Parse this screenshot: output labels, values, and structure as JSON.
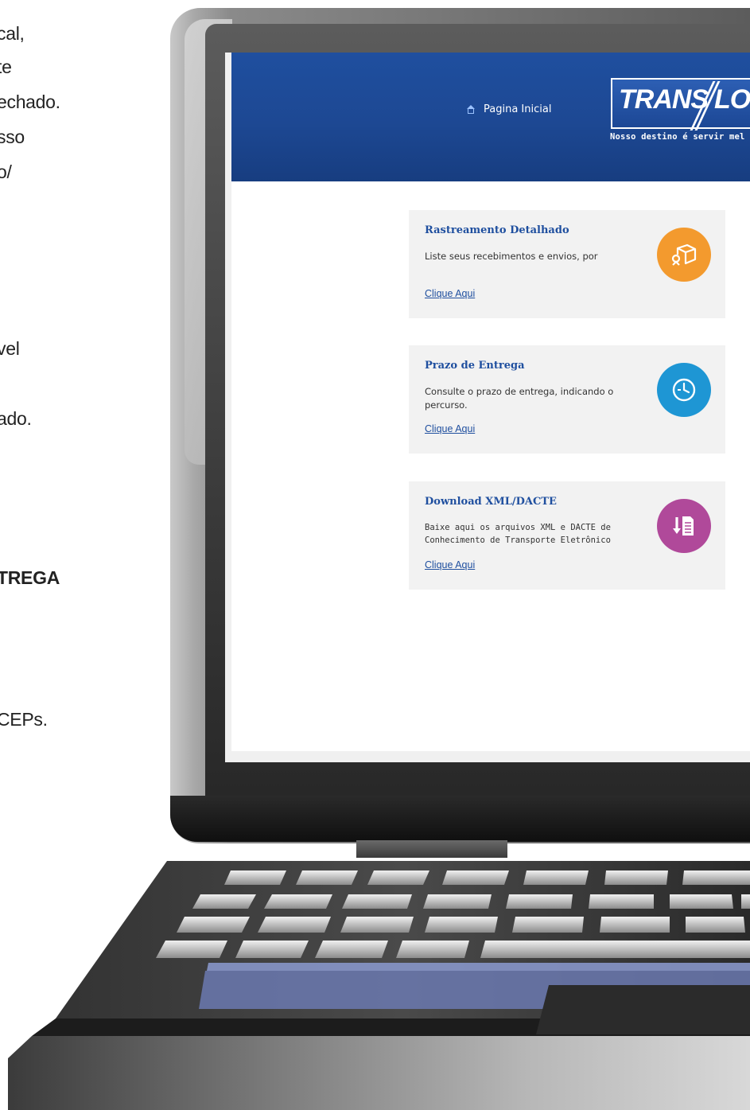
{
  "left_text": {
    "lines": [
      {
        "text": "cal,",
        "bold": false
      },
      {
        "text": "te",
        "bold": false
      },
      {
        "text": "echado.",
        "bold": false
      },
      {
        "text": "sso",
        "bold": false
      },
      {
        "text": "o/",
        "bold": false
      },
      {
        "text": "vel",
        "bold": false
      },
      {
        "text": "ado.",
        "bold": false
      },
      {
        "text": "TREGA",
        "bold": true
      },
      {
        "text": "CEPs.",
        "bold": false
      }
    ]
  },
  "header": {
    "home_label": "Pagina Inicial",
    "logo_left": "TRANS",
    "logo_right": "LOV",
    "tagline": "Nosso destino é servir mel"
  },
  "cards": [
    {
      "title": "Rastreamento Detalhado",
      "description": "Liste seus recebimentos e envios, por",
      "link": "Clique Aqui",
      "icon": "package-icon",
      "color": "#f39a2e"
    },
    {
      "title": "Prazo de Entrega",
      "description": "Consulte o prazo de entrega, indicando o percurso.",
      "link": "Clique Aqui",
      "icon": "clock-icon",
      "color": "#1e96d4"
    },
    {
      "title": "Download XML/DACTE",
      "description": "Baixe aqui os arquivos XML e DACTE de Conhecimento de Transporte Eletrônico",
      "link": "Clique Aqui",
      "icon": "document-download-icon",
      "color": "#b0499a"
    }
  ],
  "colors": {
    "header_blue": "#1d4893",
    "link_blue": "#1f4f9f"
  }
}
